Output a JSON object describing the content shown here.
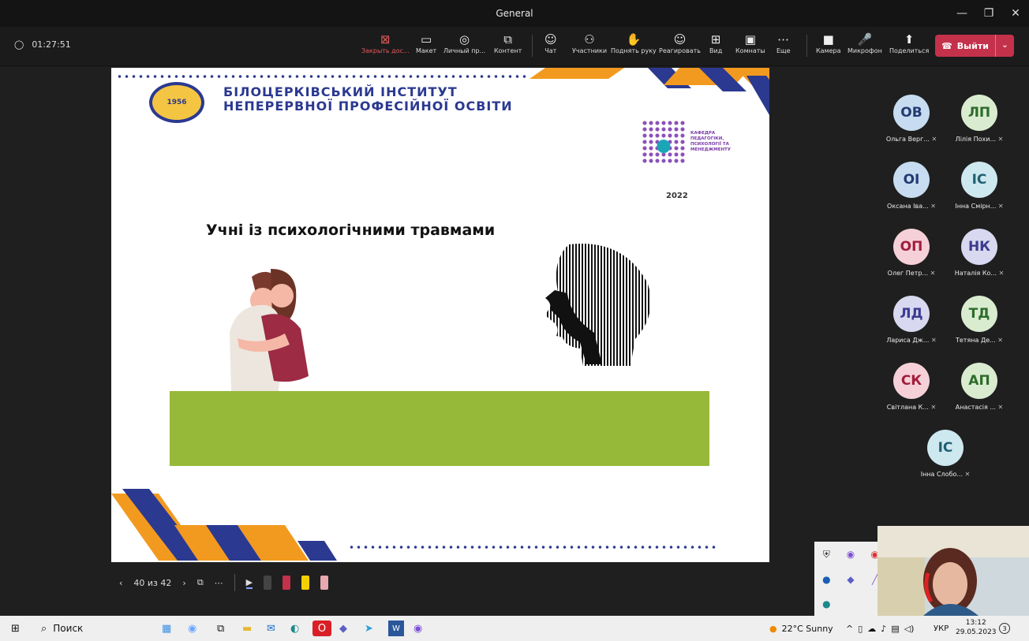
{
  "window": {
    "title": "General",
    "controls": [
      "—",
      "❐",
      "✕"
    ]
  },
  "meeting": {
    "timer": "01:27:51"
  },
  "toolbar": {
    "items": [
      {
        "label": "Закрыть дос...",
        "icon": "close-share-icon",
        "glyph": "⊠"
      },
      {
        "label": "Макет",
        "icon": "layout-icon",
        "glyph": "▭"
      },
      {
        "label": "Личный пр...",
        "icon": "private-view-icon",
        "glyph": "◎"
      },
      {
        "label": "Контент",
        "icon": "content-icon",
        "glyph": "⧉"
      },
      {
        "label": "Чат",
        "icon": "chat-icon",
        "glyph": "☺"
      },
      {
        "label": "Участники",
        "icon": "participants-icon",
        "glyph": "⚇"
      },
      {
        "label": "Поднять руку",
        "icon": "raise-hand-icon",
        "glyph": "✋"
      },
      {
        "label": "Реагировать",
        "icon": "react-icon",
        "glyph": "☺"
      },
      {
        "label": "Вид",
        "icon": "view-icon",
        "glyph": "⊞"
      },
      {
        "label": "Комнаты",
        "icon": "rooms-icon",
        "glyph": "▣"
      },
      {
        "label": "Еще",
        "icon": "more-icon",
        "glyph": "⋯"
      },
      {
        "label": "Камера",
        "icon": "camera-icon",
        "glyph": "■"
      },
      {
        "label": "Микрофон",
        "icon": "microphone-icon",
        "glyph": "🎤"
      },
      {
        "label": "Поделиться",
        "icon": "share-icon",
        "glyph": "⬆"
      }
    ],
    "leave_label": "Выйти"
  },
  "slide": {
    "institute_line1": "БІЛОЦЕРКІВСЬКИЙ ІНСТИТУТ",
    "institute_line2": "НЕПЕРЕРВНОЇ ПРОФЕСІЙНОЇ ОСВІТИ",
    "department": "КАФЕДРА ПЕДАГОГІКИ, ПСИХОЛОГІЇ ТА МЕНЕДЖМЕНТУ",
    "year": "2022",
    "title": "Учні із психологічними травмами"
  },
  "slide_controls": {
    "counter": "40 из 42"
  },
  "participants": [
    {
      "initials": "ОВ",
      "name": "Ольга Верг...",
      "bg": "#c7dcf0",
      "fg": "#243a73"
    },
    {
      "initials": "ЛП",
      "name": "Лілія Похи...",
      "bg": "#d9ecd0",
      "fg": "#2e6b2b"
    },
    {
      "initials": "ОІ",
      "name": "Оксана Іва...",
      "bg": "#c7dcf0",
      "fg": "#243a73"
    },
    {
      "initials": "ІС",
      "name": "Інна Смірн...",
      "bg": "#cde8ee",
      "fg": "#1e5f73"
    },
    {
      "initials": "ОП",
      "name": "Олег Петр...",
      "bg": "#f6d0d8",
      "fg": "#a21d3c"
    },
    {
      "initials": "НК",
      "name": "Наталія Ко...",
      "bg": "#d8d8f0",
      "fg": "#3b3b8f"
    },
    {
      "initials": "ЛД",
      "name": "Лариса Дж...",
      "bg": "#d8d8f0",
      "fg": "#3b3b8f"
    },
    {
      "initials": "ТД",
      "name": "Тетяна Де...",
      "bg": "#d9ecd0",
      "fg": "#2e6b2b"
    },
    {
      "initials": "СК",
      "name": "Світлана К...",
      "bg": "#f6d0d8",
      "fg": "#a21d3c"
    },
    {
      "initials": "АП",
      "name": "Анастасія ...",
      "bg": "#d9ecd0",
      "fg": "#2e6b2b"
    },
    {
      "initials": "ІС",
      "name": "Інна Слобо...",
      "bg": "#cde8ee",
      "fg": "#1e5f73"
    }
  ],
  "taskbar": {
    "search_label": "Поиск",
    "weather": "22°C  Sunny",
    "language": "УКР",
    "time": "13:12",
    "date": "29.05.2023",
    "notifications": "3"
  }
}
